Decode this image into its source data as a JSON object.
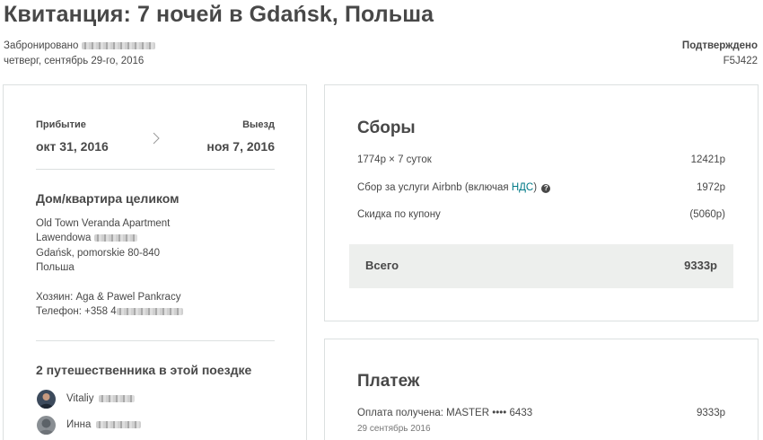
{
  "header": {
    "title": "Квитанция: 7 ночей в Gdańsk, Польша",
    "booked_label": "Забронировано",
    "booked_date": "четверг, сентябрь 29-го, 2016",
    "status": "Подтверждено",
    "code": "F5J422"
  },
  "trip": {
    "checkin_label": "Прибытие",
    "checkin_date": "окт 31, 2016",
    "checkout_label": "Выезд",
    "checkout_date": "ноя 7, 2016",
    "listing_type": "Дом/квартира целиком",
    "address": {
      "line1": "Old Town Veranda Apartment",
      "line2": "Lawendowa",
      "line3": "Gdańsk, pomorskie 80-840",
      "line4": "Польша"
    },
    "host_line": "Хозяин: Aga & Pawel Pankracy",
    "phone_line": "Телефон: +358 4",
    "guests_title": "2 путешественника в этой поездке",
    "guests": [
      {
        "name": "Vitaliy"
      },
      {
        "name": "Инна"
      }
    ]
  },
  "fees": {
    "title": "Сборы",
    "rows": [
      {
        "label": "1774р × 7 суток",
        "value": "12421р"
      },
      {
        "label": "Сбор за услуги Airbnb (включая ",
        "link": "НДС",
        "label_end": ")",
        "value": "1972р"
      },
      {
        "label": "Скидка по купону",
        "value": "(5060р)"
      }
    ],
    "total_label": "Всего",
    "total_value": "9333р"
  },
  "payment": {
    "title": "Платеж",
    "line": "Оплата получена: MASTER •••• 6433",
    "value": "9333р",
    "date": "29 сентябрь 2016"
  }
}
